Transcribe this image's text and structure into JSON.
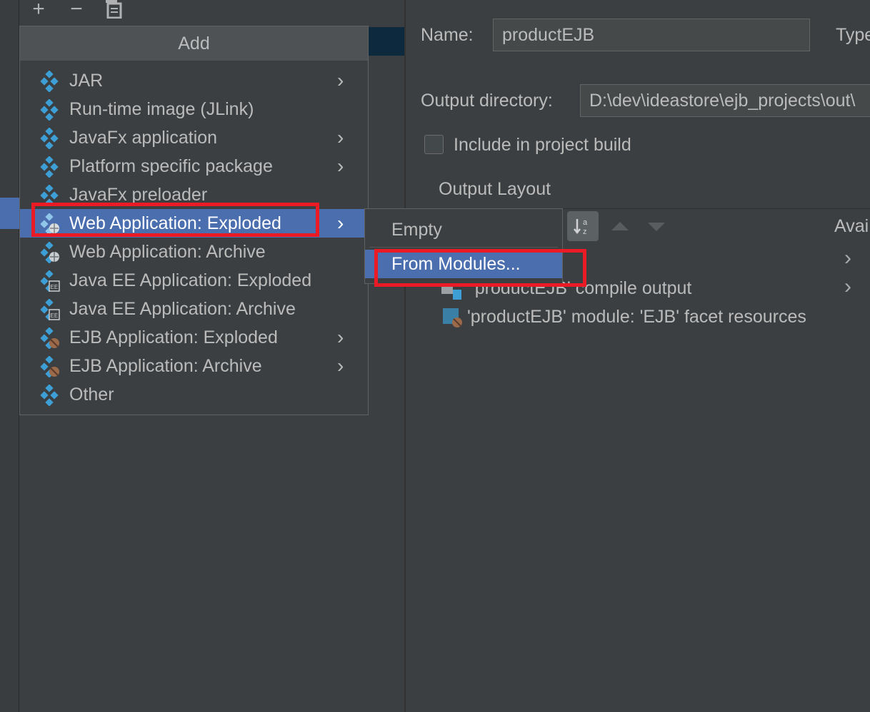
{
  "toolbar": {
    "add_icon": "plus-icon",
    "remove_icon": "minus-icon",
    "copy_icon": "copy-icon",
    "add_glyph": "+",
    "remove_glyph": "−"
  },
  "artifact": {
    "name_label": "Name:",
    "name_value": "productEJB",
    "type_label": "Type",
    "output_dir_label": "Output directory:",
    "output_dir_value": "D:\\dev\\ideastore\\ejb_projects\\out\\",
    "include_build_label": "Include in project build",
    "output_layout_label": "Output Layout",
    "available_label": "Avai",
    "layout_items": [
      {
        "label": "'productEJB' compile output",
        "icon": "module-output-icon"
      },
      {
        "label": "'productEJB' module: 'EJB' facet resources",
        "icon": "ejb-facet-icon"
      }
    ]
  },
  "add_menu": {
    "title": "Add",
    "items": [
      {
        "label": "JAR",
        "icon": "artifact-icon",
        "submenu": true
      },
      {
        "label": "Run-time image (JLink)",
        "icon": "artifact-icon",
        "submenu": false
      },
      {
        "label": "JavaFx application",
        "icon": "artifact-icon",
        "submenu": true
      },
      {
        "label": "Platform specific package",
        "icon": "artifact-icon",
        "submenu": true
      },
      {
        "label": "JavaFx preloader",
        "icon": "artifact-icon",
        "submenu": false
      },
      {
        "label": "Web Application: Exploded",
        "icon": "web-artifact-icon",
        "submenu": true,
        "selected": true
      },
      {
        "label": "Web Application: Archive",
        "icon": "web-artifact-icon",
        "submenu": false
      },
      {
        "label": "Java EE Application: Exploded",
        "icon": "javaee-artifact-icon",
        "submenu": false
      },
      {
        "label": "Java EE Application: Archive",
        "icon": "javaee-artifact-icon",
        "submenu": false
      },
      {
        "label": "EJB Application: Exploded",
        "icon": "ejb-artifact-icon",
        "submenu": true
      },
      {
        "label": "EJB Application: Archive",
        "icon": "ejb-artifact-icon",
        "submenu": true
      },
      {
        "label": "Other",
        "icon": "artifact-icon",
        "submenu": false
      }
    ]
  },
  "submenu": {
    "items": [
      {
        "label": "Empty"
      },
      {
        "label": "From Modules...",
        "selected": true
      }
    ]
  },
  "colors": {
    "background": "#3c3f41",
    "selection": "#4b6eaf",
    "highlight_box": "#ea1b25",
    "icon_blue": "#3d9fd6"
  }
}
